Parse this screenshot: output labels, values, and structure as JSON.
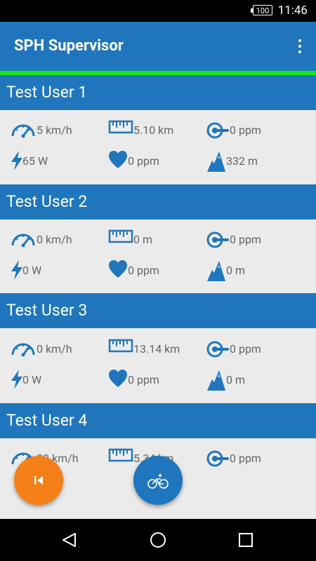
{
  "status": {
    "battery": "100",
    "time": "11:46"
  },
  "app": {
    "title": "SPH Supervisor"
  },
  "users": [
    {
      "name": "Test User 1",
      "speed": "5 km/h",
      "distance": "5.10 km",
      "cadence": "0 ppm",
      "power": "65 W",
      "heart": "0 ppm",
      "altitude": "332 m"
    },
    {
      "name": "Test User 2",
      "speed": "0 km/h",
      "distance": "0 m",
      "cadence": "0 ppm",
      "power": "0 W",
      "heart": "0 ppm",
      "altitude": "0 m"
    },
    {
      "name": "Test User 3",
      "speed": "0 km/h",
      "distance": "13.14 km",
      "cadence": "0 ppm",
      "power": "0 W",
      "heart": "0 ppm",
      "altitude": "0 m"
    },
    {
      "name": "Test User 4",
      "speed": "38 km/h",
      "distance": "5.34 km",
      "cadence": "0 ppm"
    }
  ],
  "colors": {
    "primary": "#1f76bd",
    "accent_green": "#17e817",
    "fab_orange": "#f57f17",
    "background": "#ebebeb"
  }
}
